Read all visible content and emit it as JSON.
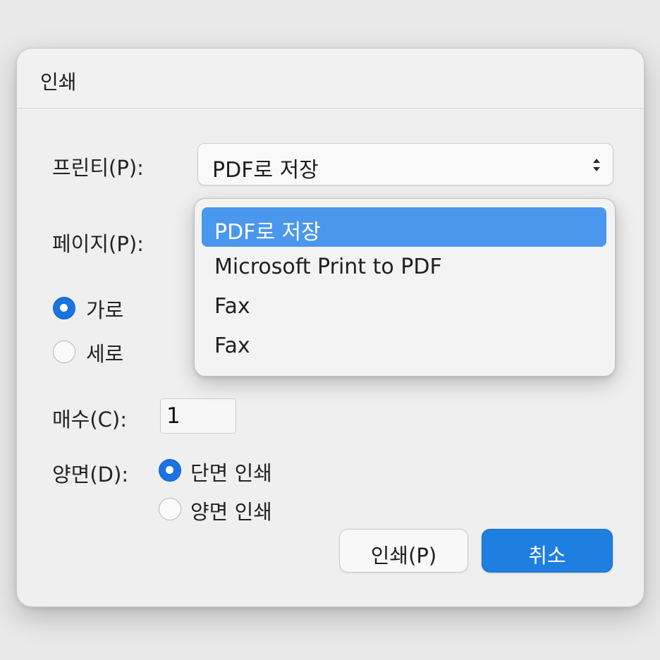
{
  "dialog": {
    "title": "인쇄"
  },
  "printer": {
    "label": "프린티(P):",
    "selected": "PDF로 저장",
    "options": [
      {
        "label": "PDF로 저장",
        "selected": true
      },
      {
        "label": "Microsoft Print to PDF",
        "selected": false
      },
      {
        "label": "Fax",
        "selected": false
      },
      {
        "label": "Fax",
        "selected": false
      }
    ]
  },
  "pages": {
    "label": "페이지(P):"
  },
  "orientation": {
    "options": [
      {
        "label": "가로",
        "checked": true
      },
      {
        "label": "세로",
        "checked": false
      }
    ]
  },
  "copies": {
    "label": "매수(C):",
    "value": "1"
  },
  "duplex": {
    "label": "양면(D):",
    "options": [
      {
        "label": "단면 인쇄",
        "checked": true
      },
      {
        "label": "양면 인쇄",
        "checked": false
      }
    ]
  },
  "buttons": {
    "print_label": "인쇄(P)",
    "cancel_label": "취소"
  },
  "colors": {
    "accent": "#1f7fe0",
    "highlight": "#4a97ee"
  },
  "icons": {
    "select_arrows": "updown-chevron-icon",
    "radio_on": "radio-checked-icon",
    "radio_off": "radio-unchecked-icon"
  }
}
